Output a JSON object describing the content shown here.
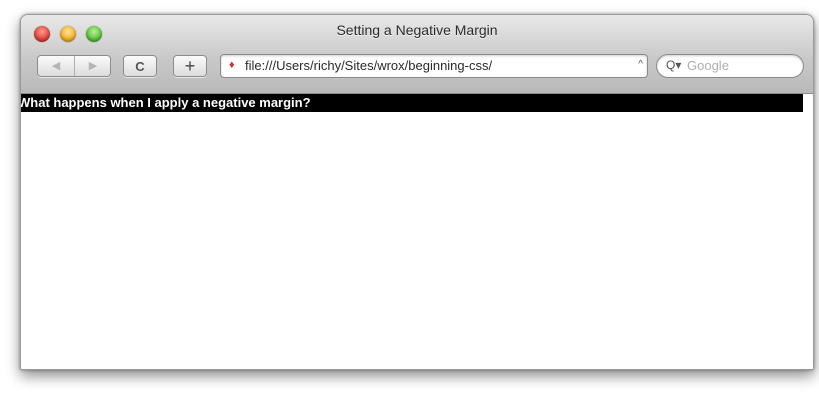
{
  "window": {
    "title": "Setting a Negative Margin"
  },
  "toolbar": {
    "back_icon": "back-arrow-icon",
    "forward_icon": "forward-arrow-icon",
    "back_glyph": "◀",
    "forward_glyph": "▶",
    "reload_glyph": "C",
    "add_glyph": "+",
    "address_url": "file:///Users/richy/Sites/wrox/beginning-css/",
    "address_dropdown_glyph": "^",
    "page_icon_glyph": "♦",
    "search_icon_glyph": "Q▾",
    "search_placeholder": "Google"
  },
  "content": {
    "heading": "What happens when I apply a negative margin?"
  },
  "colors": {
    "heading_background": "#000000",
    "heading_text": "#ffffff"
  }
}
